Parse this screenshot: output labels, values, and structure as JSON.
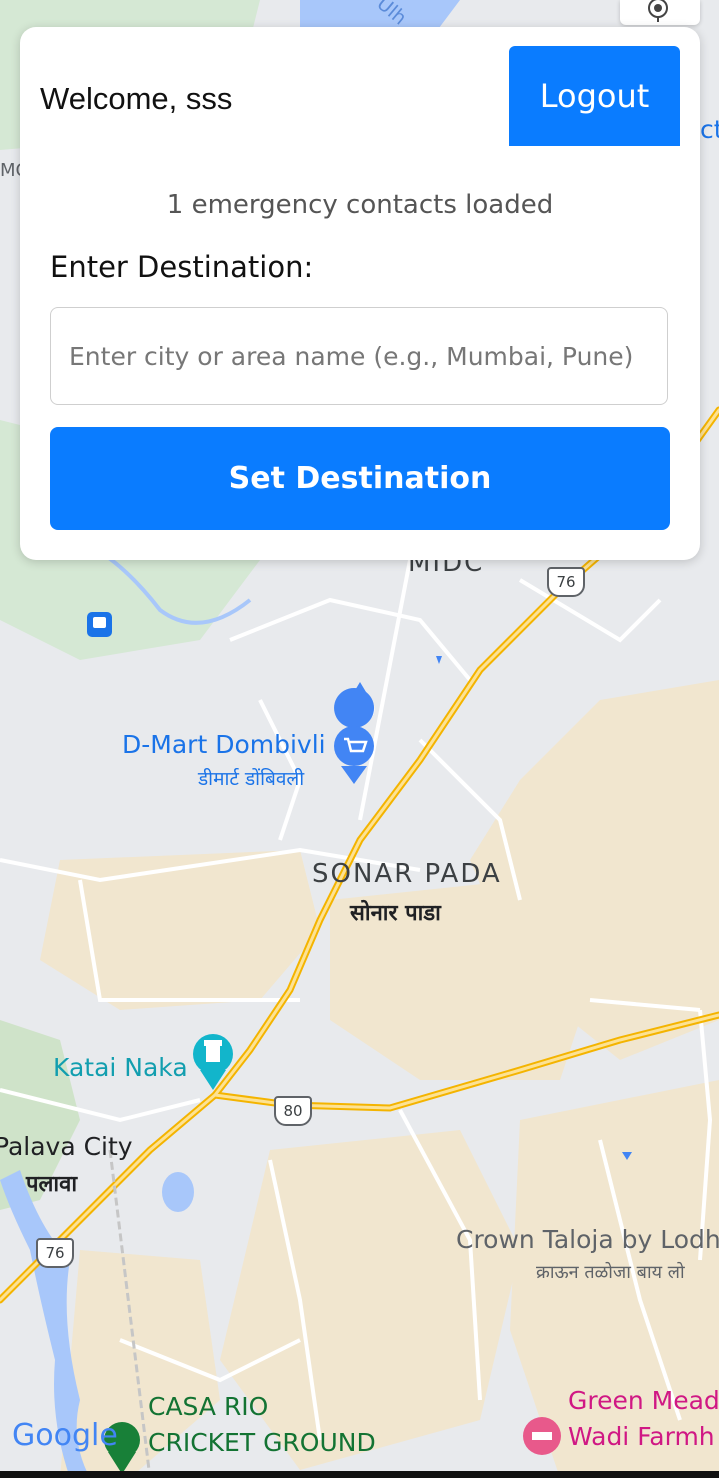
{
  "header": {
    "welcome": "Welcome, sss",
    "logout_label": "Logout"
  },
  "status": {
    "contacts_text": "1 emergency contacts loaded"
  },
  "destination": {
    "label": "Enter Destination:",
    "placeholder": "Enter city or area name (e.g., Mumbai, Pune)",
    "value": "",
    "button_label": "Set Destination"
  },
  "map": {
    "labels": {
      "midc": "MIDC",
      "dmart_en": "D-Mart Dombivli",
      "dmart_hi": "डीमार्ट डोंबिवली",
      "sonar_en": "SONAR PADA",
      "sonar_hi": "सोनार पाडा",
      "katai": "Katai Naka",
      "palava_en": "Palava City",
      "palava_hi": "पलावा",
      "crown_en": "Crown Taloja by Lodh",
      "crown_hi": "क्राऊन तळोजा बाय लो",
      "casa_1": "CASA RIO",
      "casa_2": "CRICKET GROUND",
      "green_1": "Green Mead",
      "green_2": "Wadi Farmh",
      "ulh": "Ulh",
      "mc": "MC",
      "ct": "ct"
    },
    "shields": {
      "nh76_top": "76",
      "nh80": "80",
      "nh76_bottom": "76"
    },
    "attribution": "Google"
  },
  "colors": {
    "accent": "#0a7cff",
    "highway": "#f4b400",
    "water": "#a8c7fa",
    "park": "#cfe3c9",
    "urban": "#f1e6cf"
  },
  "icons": {
    "locate": "crosshair-icon",
    "shop": "cart-pin-icon",
    "landmark": "tower-pin-icon",
    "location": "blue-dot-icon",
    "transit": "train-icon",
    "hotel": "bed-pin-icon"
  }
}
